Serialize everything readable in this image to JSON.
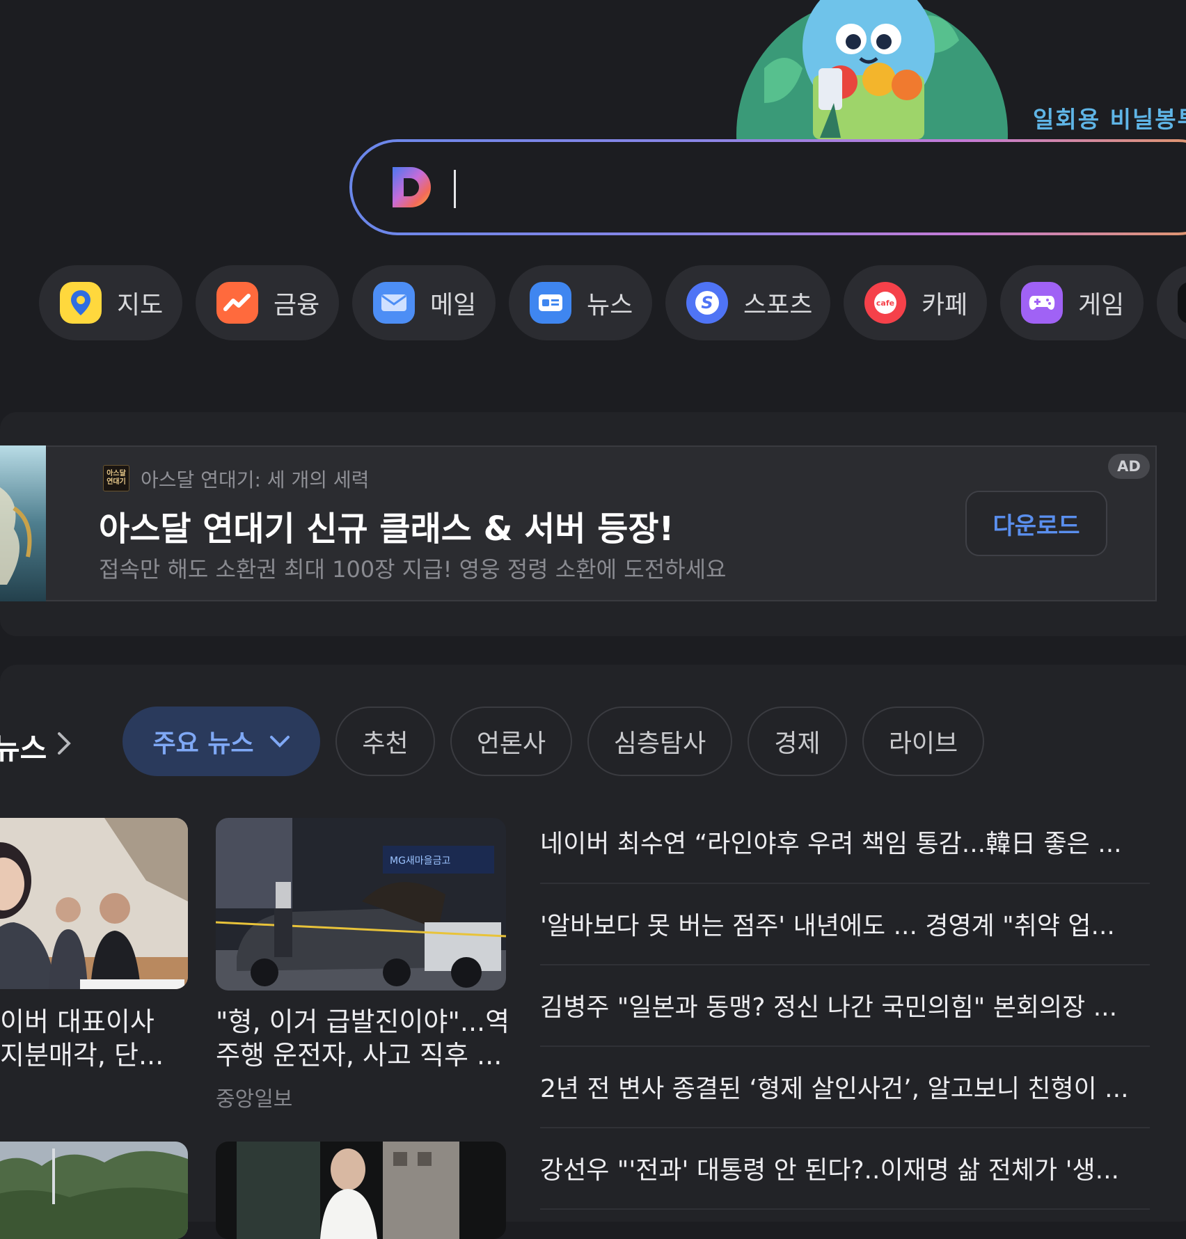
{
  "doodle": {
    "caption": "일회용 비닐봉투"
  },
  "search": {
    "logo": "D",
    "value": ""
  },
  "shortcuts": [
    {
      "label": "지도",
      "icon": "map-pin-icon",
      "color": "#ffd83d"
    },
    {
      "label": "금융",
      "icon": "trend-up-icon",
      "color": "#ff6a3d"
    },
    {
      "label": "메일",
      "icon": "mail-icon",
      "color": "#4d8ef5"
    },
    {
      "label": "뉴스",
      "icon": "news-icon",
      "color": "#3f86f0"
    },
    {
      "label": "스포츠",
      "icon": "sports-icon",
      "color": "#4f74f5"
    },
    {
      "label": "카페",
      "icon": "cafe-icon",
      "color": "#f5414a"
    },
    {
      "label": "게임",
      "icon": "game-icon",
      "color": "#a062f5"
    }
  ],
  "ad": {
    "brand_logo_text": "아스달 연대기",
    "source": "아스달 연대기: 세 개의 세력",
    "title": "아스달 연대기 신규 클래스 & 서버 등장!",
    "description": "접속만 해도 소환권 최대 100장 지급! 영웅 정령 소환에 도전하세요",
    "badge": "AD",
    "button": "다운로드"
  },
  "news": {
    "heading": "뉴스",
    "tabs": [
      {
        "label": "주요 뉴스",
        "active": true
      },
      {
        "label": "추천"
      },
      {
        "label": "언론사"
      },
      {
        "label": "심층탐사"
      },
      {
        "label": "경제"
      },
      {
        "label": "라이브"
      }
    ],
    "cards": [
      {
        "title_line1": "이버 대표이사",
        "title_line2": "지분매각, 단...",
        "source": ""
      },
      {
        "title_line1": "\"형, 이거 급발진이야\"...역",
        "title_line2": "주행 운전자, 사고 직후 ...",
        "source": "중앙일보"
      }
    ],
    "headlines": [
      "네이버 최수연 “라인야후 우려 책임 통감...韓日 좋은 ...",
      "'알바보다 못 버는 점주' 내년에도 ... 경영계 \"취약 업...",
      "김병주 \"일본과 동맹? 정신 나간 국민의힘\" 본회의장 ...",
      "2년 전 변사 종결된 ‘형제 살인사건’, 알고보니 친형이 ...",
      "강선우 \"'전과' 대통령 안 된다?..이재명 삶 전체가 '생..."
    ]
  }
}
